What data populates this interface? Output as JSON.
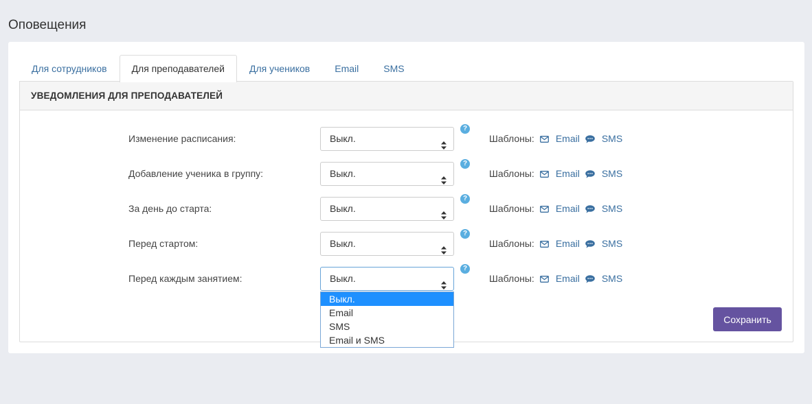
{
  "page": {
    "title": "Оповещения"
  },
  "tabs": [
    {
      "label": "Для сотрудников",
      "active": false
    },
    {
      "label": "Для преподавателей",
      "active": true
    },
    {
      "label": "Для учеников",
      "active": false
    },
    {
      "label": "Email",
      "active": false
    },
    {
      "label": "SMS",
      "active": false
    }
  ],
  "panel": {
    "heading": "УВЕДОМЛЕНИЯ ДЛЯ ПРЕПОДАВАТЕЛЕЙ"
  },
  "rows": [
    {
      "label": "Изменение расписания:",
      "value": "Выкл.",
      "help": "?",
      "templates_label": "Шаблоны:",
      "email_link": "Email",
      "sms_link": "SMS"
    },
    {
      "label": "Добавление ученика в группу:",
      "value": "Выкл.",
      "help": "?",
      "templates_label": "Шаблоны:",
      "email_link": "Email",
      "sms_link": "SMS"
    },
    {
      "label": "За день до старта:",
      "value": "Выкл.",
      "help": "?",
      "templates_label": "Шаблоны:",
      "email_link": "Email",
      "sms_link": "SMS"
    },
    {
      "label": "Перед стартом:",
      "value": "Выкл.",
      "help": "?",
      "templates_label": "Шаблоны:",
      "email_link": "Email",
      "sms_link": "SMS"
    },
    {
      "label": "Перед каждым занятием:",
      "value": "Выкл.",
      "help": "?",
      "templates_label": "Шаблоны:",
      "email_link": "Email",
      "sms_link": "SMS"
    }
  ],
  "dropdown": {
    "options": [
      "Выкл.",
      "Email",
      "SMS",
      "Email и SMS"
    ],
    "selected_index": 0
  },
  "actions": {
    "save_label": "Сохранить"
  },
  "colors": {
    "link": "#3a6fa0",
    "save_button": "#6553a0",
    "help_icon": "#5aaee0",
    "dropdown_highlight": "#1e90ff",
    "background": "#eaecf1"
  },
  "icons": {
    "email": "envelope-icon",
    "sms": "chat-bubble-icon",
    "help": "question-circle-icon",
    "select": "select-arrows-icon"
  }
}
